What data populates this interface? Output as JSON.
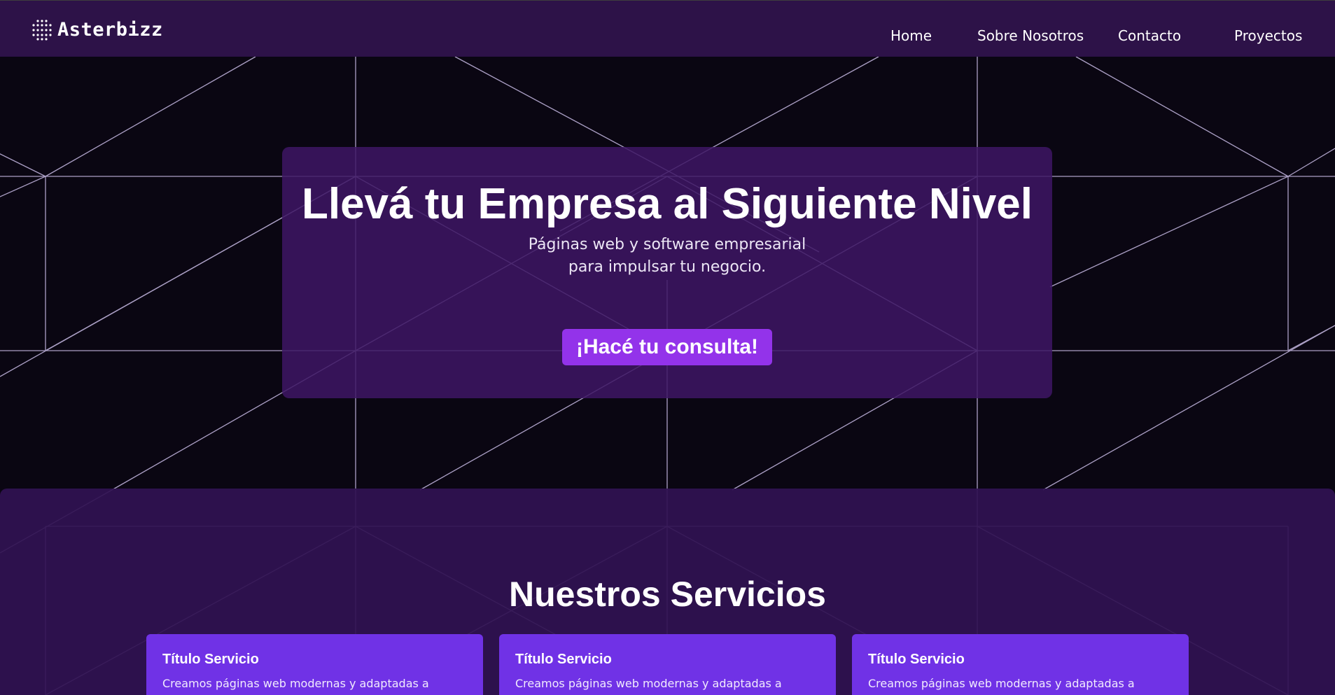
{
  "brand": {
    "name": "Asterbizz",
    "logo_icon": "dot-grid-icon"
  },
  "nav": {
    "items": [
      {
        "label": "Home"
      },
      {
        "label": "Sobre Nosotros"
      },
      {
        "label": "Contacto"
      },
      {
        "label": "Proyectos"
      }
    ]
  },
  "hero": {
    "title": "Llevá tu Empresa al Siguiente Nivel",
    "subtitle_line1": "Páginas web y software empresarial",
    "subtitle_line2": "para impulsar tu negocio.",
    "cta_label": "¡Hacé tu consulta!"
  },
  "services": {
    "title": "Nuestros Servicios",
    "cards": [
      {
        "title": "Título Servicio",
        "description": "Creamos páginas web modernas y adaptadas a"
      },
      {
        "title": "Título Servicio",
        "description": "Creamos páginas web modernas y adaptadas a"
      },
      {
        "title": "Título Servicio",
        "description": "Creamos páginas web modernas y adaptadas a"
      }
    ]
  },
  "colors": {
    "navbar_bg": "#2d1248",
    "page_bg": "#0a0612",
    "hero_card_bg": "#3e1664",
    "accent": "#9333ea",
    "service_card_bg": "#7032e6",
    "grid_line": "#c9bce6"
  }
}
